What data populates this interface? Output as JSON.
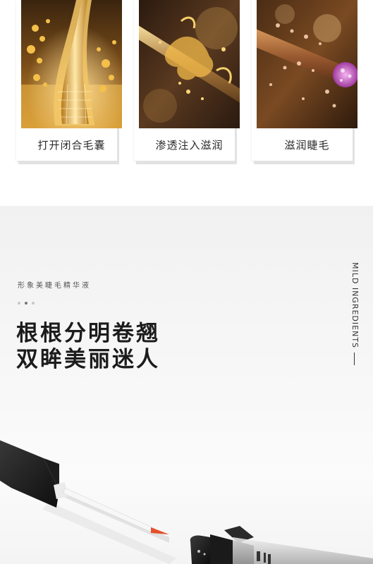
{
  "feature_cards": [
    {
      "caption": "打开闭合毛囊",
      "image": "golden hair follicle with oil bubbles"
    },
    {
      "caption": "渗透注入滋润",
      "image": "golden serum splash on lash strand"
    },
    {
      "caption": "滋润睫毛",
      "image": "nourished lash with bubbles"
    }
  ],
  "product": {
    "subtitle": "形象美睫毛精华液",
    "headline_line1": "根根分明卷翘",
    "headline_line2": "双眸美丽迷人",
    "side_label": "MILD INGREDIENTS",
    "carousel_dots": 3,
    "active_dot": 1,
    "image": "eyelash serum applicator and bottle"
  },
  "colors": {
    "text_dark": "#1c1c1c",
    "dot_active": "#777777",
    "dot_inactive": "#c8c8c8",
    "gold": "#d6a23a",
    "brown": "#3a2314",
    "brush_red": "#e4502a"
  }
}
